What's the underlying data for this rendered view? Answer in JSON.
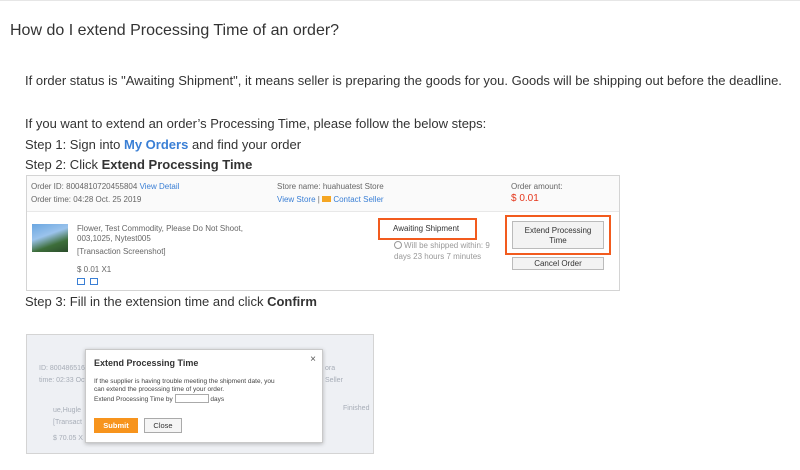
{
  "title": "How do I extend Processing Time of an order?",
  "intro": "If order status is \"Awaiting Shipment\", it means seller is preparing the goods for you. Goods will be shipping out before the deadline.",
  "steps_intro": "If you want to extend an order’s Processing Time, please follow the below steps:",
  "step1": {
    "prefix": "Step 1: Sign into ",
    "link": "My Orders",
    "suffix": " and find your order"
  },
  "step2": {
    "prefix": "Step 2: Click ",
    "bold": "Extend Processing Time"
  },
  "step3": {
    "prefix": "Step 3: Fill in the extension time and click ",
    "bold": "Confirm"
  },
  "order_screenshot": {
    "order_id_label": "Order ID:",
    "order_id": "8004810720455804",
    "view_detail": "View Detail",
    "order_time_label": "Order time:",
    "order_time": "04:28 Oct. 25 2019",
    "store_name_label": "Store name:",
    "store_name": "huahuatest Store",
    "view_store": "View Store",
    "separator": "|",
    "contact_seller": "Contact Seller",
    "order_amount_label": "Order amount:",
    "order_amount": "$ 0.01",
    "product_title_line1": "Flower, Test Commodity, Please Do Not Shoot,",
    "product_title_line2": "003,1025, Nytest005",
    "transaction_screenshot": "[Transaction Screenshot]",
    "price_qty": "$ 0.01 X1",
    "status": "Awaiting Shipment",
    "ship_note_line1": "Will be shipped within: 9",
    "ship_note_line2": "days 23 hours 7 minutes",
    "extend_btn_line1": "Extend Processing",
    "extend_btn_line2": "Time",
    "cancel_btn": "Cancel Order",
    "colors": {
      "highlight": "#f25b1e",
      "amount": "#e5361b",
      "link": "#3a7fd5"
    }
  },
  "dialog_screenshot": {
    "title": "Extend Processing Time",
    "close": "×",
    "text_line1": "If the supplier is having trouble meeting the shipment date, you",
    "text_line2": "can extend the processing time of your order.",
    "field_label": "Extend Processing Time by",
    "field_unit": "days",
    "submit": "Submit",
    "close_btn": "Close",
    "bg_text": {
      "order_id": "ID: 8004865163",
      "order_time": "time: 02:33 Oct",
      "ora": "ora",
      "seller": "Seller",
      "product1": "ue,Hugle",
      "product2": "[Transact",
      "price": "$ 70.05 X",
      "finished": "Finished"
    },
    "colors": {
      "submit_bg": "#f7941d"
    }
  },
  "colors": {
    "link": "#3a7fd5",
    "text": "#333333"
  }
}
